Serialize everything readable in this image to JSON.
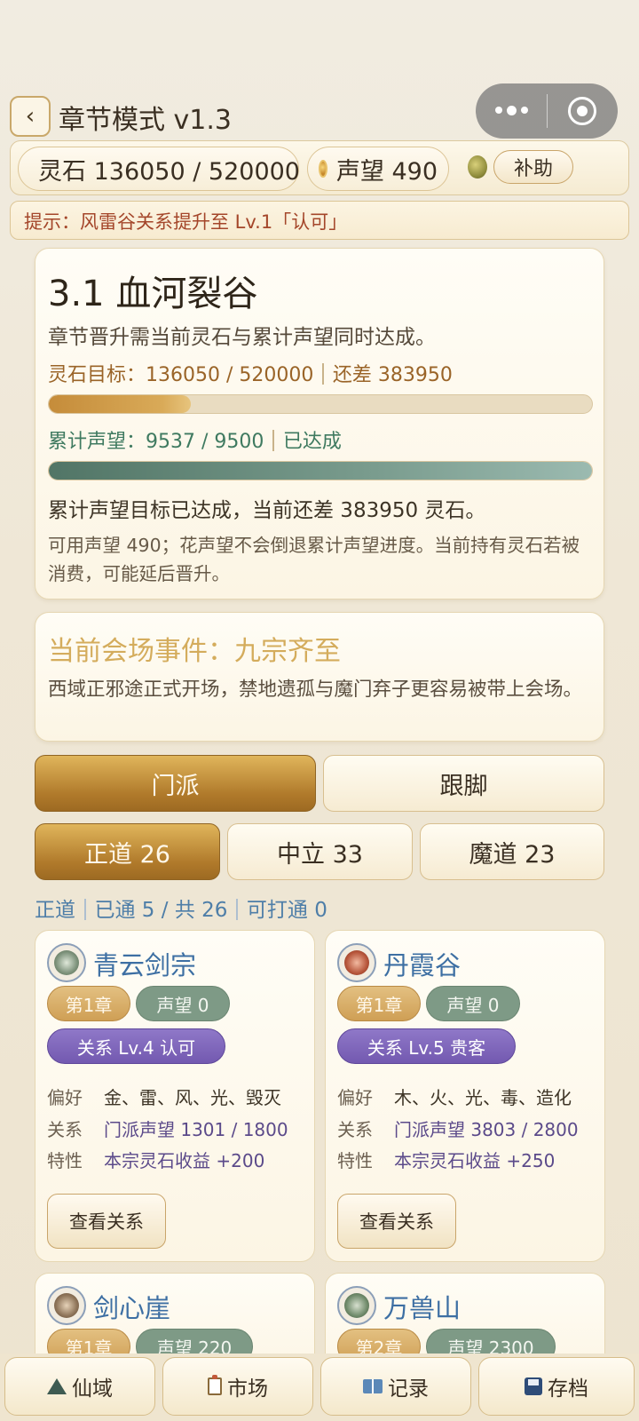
{
  "header": {
    "back_icon": "‹",
    "title": "章节模式 v1.3"
  },
  "resources": {
    "spirit_stone_label": "灵石 136050 / 520000",
    "reputation_label": "声望 490",
    "help_label": "补助"
  },
  "hint": {
    "text": "提示：风雷谷关系提升至 Lv.1「认可」"
  },
  "chapter": {
    "title": "3.1 血河裂谷",
    "description": "章节晋升需当前灵石与累计声望同时达成。",
    "stone_target_label": "灵石目标：136050 / 520000",
    "stone_remaining": "还差 383950",
    "stone_progress": 0.262,
    "rep_label": "累计声望：9537 / 9500",
    "rep_status": "已达成",
    "rep_progress": 1.0,
    "status_text": "累计声望目标已达成，当前还差 383950 灵石。",
    "note": "可用声望 490；花声望不会倒退累计声望进度。当前持有灵石若被消费，可能延后晋升。"
  },
  "event": {
    "title": "当前会场事件：九宗齐至",
    "description": "西域正邪途正式开场，禁地遗孤与魔门弃子更容易被带上会场。"
  },
  "main_tabs": [
    {
      "label": "门派",
      "active": true
    },
    {
      "label": "跟脚",
      "active": false
    }
  ],
  "faction_tabs": [
    {
      "label": "正道 26",
      "active": true
    },
    {
      "label": "中立 33",
      "active": false
    },
    {
      "label": "魔道 23",
      "active": false
    }
  ],
  "filter": {
    "faction": "正道",
    "cleared": "已通 5 / 共 26",
    "clearable": "可打通 0"
  },
  "sects": [
    {
      "name": "青云剑宗",
      "emblem": "sword-emblem-icon",
      "chapter": "第1章",
      "reputation": "声望 0",
      "relation": "关系 Lv.4 认可",
      "pref_label": "偏好",
      "pref": "金、雷、风、光、毁灭",
      "rel_label": "关系",
      "rel_value": "门派声望 1301 / 1800",
      "trait_label": "特性",
      "trait": "本宗灵石收益 +200",
      "button": "查看关系"
    },
    {
      "name": "丹霞谷",
      "emblem": "cauldron-emblem-icon",
      "chapter": "第1章",
      "reputation": "声望 0",
      "relation": "关系 Lv.5 贵客",
      "pref_label": "偏好",
      "pref": "木、火、光、毒、造化",
      "rel_label": "关系",
      "rel_value": "门派声望 3803 / 2800",
      "trait_label": "特性",
      "trait": "本宗灵石收益 +250",
      "button": "查看关系"
    },
    {
      "name": "剑心崖",
      "emblem": "cliff-emblem-icon",
      "chapter": "第1章",
      "reputation": "声望 220"
    },
    {
      "name": "万兽山",
      "emblem": "beast-emblem-icon",
      "chapter": "第2章",
      "reputation": "声望 2300"
    }
  ],
  "bottom_nav": [
    {
      "label": "仙域",
      "icon": "mountain-icon"
    },
    {
      "label": "市场",
      "icon": "clipboard-icon"
    },
    {
      "label": "记录",
      "icon": "book-icon"
    },
    {
      "label": "存档",
      "icon": "save-disk-icon"
    }
  ]
}
